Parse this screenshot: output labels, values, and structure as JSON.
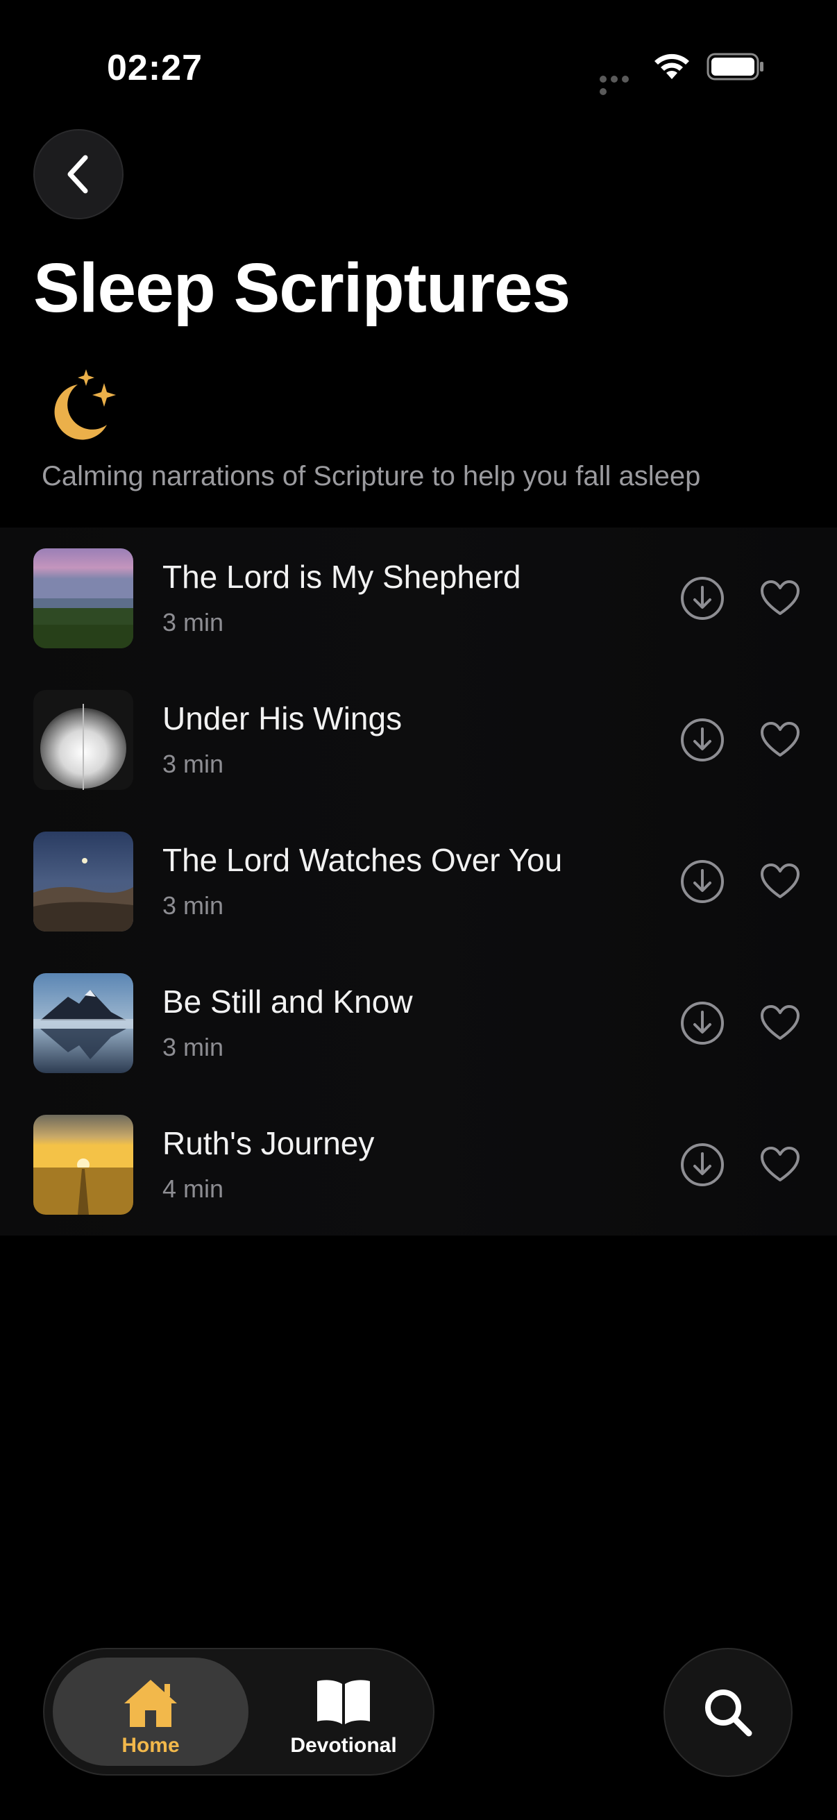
{
  "status_bar": {
    "time": "02:27"
  },
  "header": {
    "back_icon": "chevron-left-icon",
    "title": "Sleep Scriptures",
    "moon_icon": "moon-stars-icon",
    "subtitle": "Calming narrations of Scripture to help you fall asleep"
  },
  "tracks": [
    {
      "title": "The Lord is My Shepherd",
      "duration": "3 min",
      "thumbnail": "pasture-dusk"
    },
    {
      "title": "Under His Wings",
      "duration": "3 min",
      "thumbnail": "white-feather"
    },
    {
      "title": "The Lord Watches Over You",
      "duration": "3 min",
      "thumbnail": "moon-over-hills"
    },
    {
      "title": "Be Still and Know",
      "duration": "3 min",
      "thumbnail": "mountain-lake"
    },
    {
      "title": "Ruth's Journey",
      "duration": "4 min",
      "thumbnail": "wheat-field-sunset"
    }
  ],
  "tab_bar": {
    "home_label": "Home",
    "devotional_label": "Devotional",
    "active_tab": "Home"
  },
  "colors": {
    "accent": "#F2B84B",
    "background": "#000000",
    "secondary_text": "#8E8E93"
  }
}
